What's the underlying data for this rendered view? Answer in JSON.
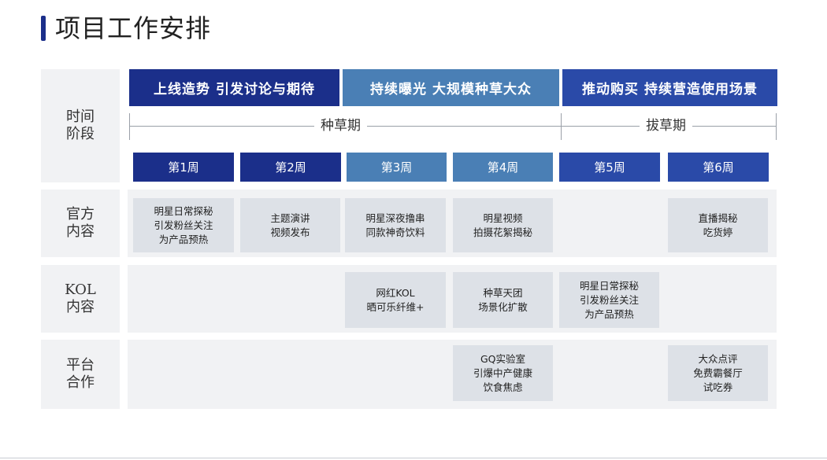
{
  "title": "项目工作安排",
  "row_labels": {
    "time": "时间\n阶段",
    "official": "官方\n内容",
    "kol": "KOL\n内容",
    "platform": "平台\n合作"
  },
  "phases": [
    {
      "label": "上线造势  引发讨论与期待",
      "color": "#1b2f8a"
    },
    {
      "label": "持续曝光  大规模种草大众",
      "color": "#4a7fb5"
    },
    {
      "label": "推动购买  持续营造使用场景",
      "color": "#2a4aa8"
    }
  ],
  "stages": [
    "种草期",
    "拔草期"
  ],
  "weeks": [
    {
      "label": "第1周",
      "color": "#1b2f8a"
    },
    {
      "label": "第2周",
      "color": "#1b2f8a"
    },
    {
      "label": "第3周",
      "color": "#4a7fb5"
    },
    {
      "label": "第4周",
      "color": "#4a7fb5"
    },
    {
      "label": "第5周",
      "color": "#2a4aa8"
    },
    {
      "label": "第6周",
      "color": "#2a4aa8"
    }
  ],
  "official": [
    "明星日常探秘\n引发粉丝关注\n为产品预热",
    "主题演讲\n视频发布",
    "明星深夜撸串\n同款神奇饮料",
    "明星视频\n拍摄花絮揭秘",
    "直播揭秘\n吃货婷"
  ],
  "kol": [
    "网红KOL\n晒可乐纤维+",
    "种草天团\n场景化扩散",
    "明星日常探秘\n引发粉丝关注\n为产品预热"
  ],
  "platform": [
    "GQ实验室\n引爆中产健康\n饮食焦虑",
    "大众点评\n免费霸餐厅\n试吃券"
  ]
}
